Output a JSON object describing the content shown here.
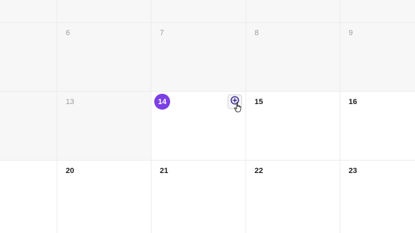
{
  "calendar": {
    "row1": {
      "d1": "6",
      "d2": "7",
      "d3": "8",
      "d4": "9"
    },
    "row2": {
      "d1": "13",
      "d2": "14",
      "d3": "15",
      "d4": "16"
    },
    "row3": {
      "d1": "20",
      "d2": "21",
      "d3": "22",
      "d4": "23"
    },
    "today": "14"
  },
  "colors": {
    "today_accent": "#7b3fe4",
    "past_bg": "#f7f7f7"
  },
  "icons": {
    "add_event": "plus-circle-icon",
    "cursor": "hand-pointer-icon"
  }
}
